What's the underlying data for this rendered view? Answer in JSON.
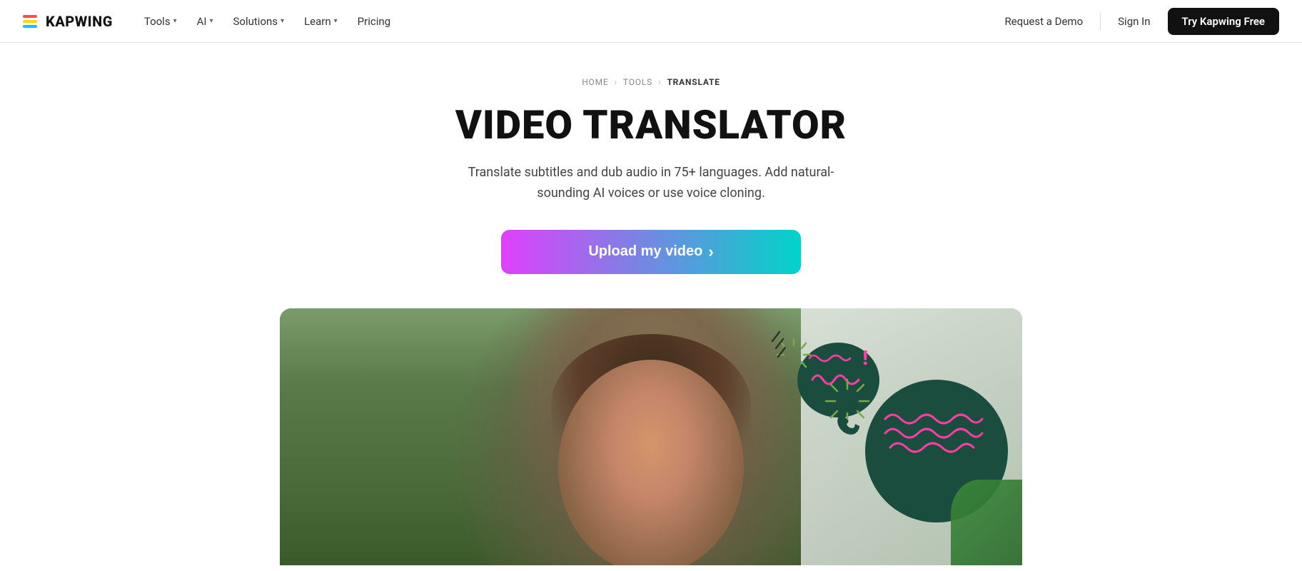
{
  "nav": {
    "logo_text": "KAPWING",
    "links": [
      {
        "label": "Tools",
        "has_chevron": true
      },
      {
        "label": "AI",
        "has_chevron": true
      },
      {
        "label": "Solutions",
        "has_chevron": true
      },
      {
        "label": "Learn",
        "has_chevron": true
      },
      {
        "label": "Pricing",
        "has_chevron": false
      }
    ],
    "btn_demo": "Request a Demo",
    "btn_signin": "Sign In",
    "btn_try": "Try Kapwing Free"
  },
  "hero": {
    "breadcrumb_home": "HOME",
    "breadcrumb_tools": "TOOLS",
    "breadcrumb_current": "TRANSLATE",
    "title": "VIDEO TRANSLATOR",
    "description": "Translate subtitles and dub audio in 75+ languages. Add natural-sounding AI voices or use voice cloning.",
    "upload_btn": "Upload my video",
    "upload_arrow": "›"
  }
}
